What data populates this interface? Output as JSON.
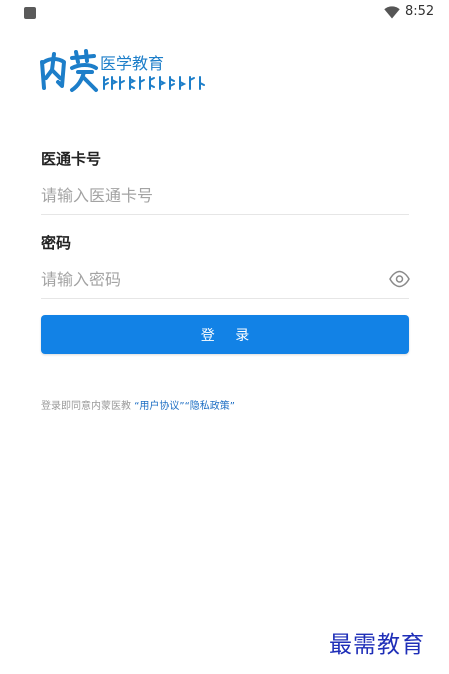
{
  "status_bar": {
    "time": "8:52",
    "app_icon": "app-square-icon",
    "wifi_icon": "wifi-icon"
  },
  "logo": {
    "text": "医学教育",
    "mark": "nei-meng-calligraphy-logo",
    "script": "mongolian-script-logo"
  },
  "form": {
    "card_label": "医通卡号",
    "card_placeholder": "请输入医通卡号",
    "password_label": "密码",
    "password_placeholder": "请输入密码",
    "password_toggle_icon": "eye-icon",
    "login_label": "登 录"
  },
  "agreement": {
    "prefix": "登录即同意内蒙医教 ",
    "user_agreement": "“用户协议”",
    "privacy_policy": "“隐私政策”"
  },
  "watermark": {
    "text": "最需教育"
  },
  "colors": {
    "primary": "#1282e6",
    "link": "#1e6fc4",
    "logo": "#1d7ec9",
    "watermark": "#1f2fb8"
  }
}
